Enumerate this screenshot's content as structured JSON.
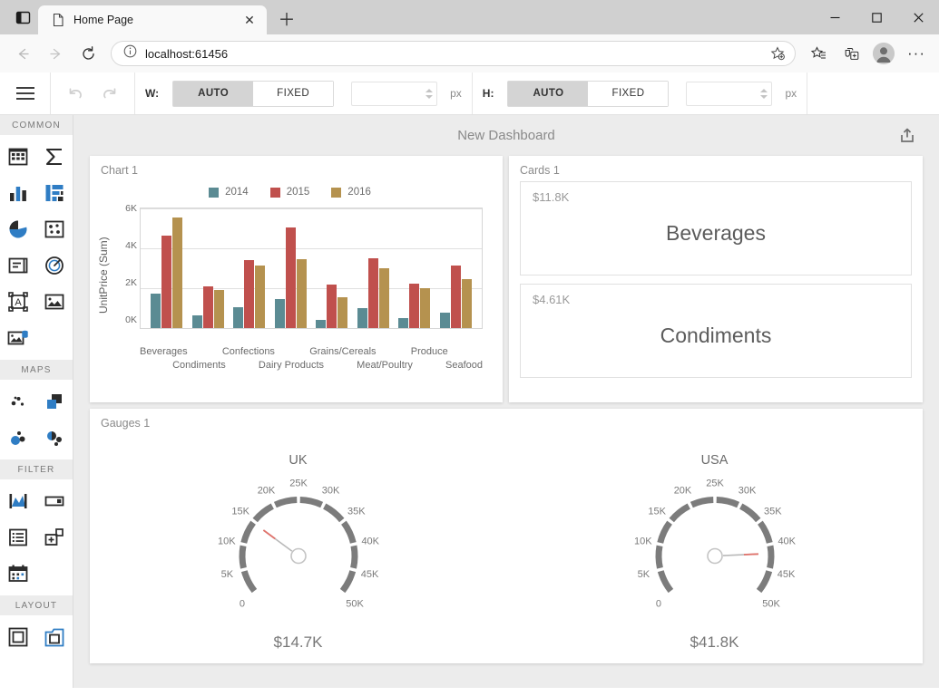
{
  "browser": {
    "tab": {
      "title": "Home Page",
      "favicon_icon": "page-icon",
      "close_icon": "close-icon"
    },
    "tab_list_icon": "tab-list-icon",
    "new_tab_icon": "plus-icon",
    "window": {
      "minimize": "minimize-icon",
      "maximize": "maximize-icon",
      "close": "close-icon"
    },
    "nav": {
      "back_icon": "back-arrow-icon",
      "forward_icon": "forward-arrow-icon",
      "reload_icon": "reload-icon",
      "info_icon": "info-circle-icon",
      "url": "localhost:61456",
      "url_host": "localhost",
      "url_port": ":61456",
      "favorite_icon": "star-add-icon",
      "collections_icon": "collections-icon",
      "tab_collection_icon": "tab-collection-icon",
      "profile_icon": "profile-avatar-icon",
      "settings_icon": "ellipsis-icon"
    }
  },
  "toolbar": {
    "menu_icon": "hamburger-menu-icon",
    "undo_icon": "undo-icon",
    "redo_icon": "redo-icon",
    "width": {
      "label": "W:",
      "auto_label": "AUTO",
      "fixed_label": "FIXED",
      "selected": "AUTO",
      "value": "",
      "unit": "px"
    },
    "height": {
      "label": "H:",
      "auto_label": "AUTO",
      "fixed_label": "FIXED",
      "selected": "AUTO",
      "value": "",
      "unit": "px"
    }
  },
  "sidebar": {
    "sections": [
      {
        "title": "COMMON",
        "items": [
          {
            "name": "grid-icon",
            "label": "Grid"
          },
          {
            "name": "sigma-icon",
            "label": "Sum"
          },
          {
            "name": "bar-chart-icon",
            "label": "Chart"
          },
          {
            "name": "pivot-grid-icon",
            "label": "Pivot"
          },
          {
            "name": "pie-chart-icon",
            "label": "Pies"
          },
          {
            "name": "scatter-chart-icon",
            "label": "Scatter"
          },
          {
            "name": "card-icon",
            "label": "Cards"
          },
          {
            "name": "gauge-icon",
            "label": "Gauges"
          },
          {
            "name": "text-box-icon",
            "label": "Text Box"
          },
          {
            "name": "image-icon",
            "label": "Image"
          },
          {
            "name": "bound-image-icon",
            "label": "Bound Image"
          }
        ]
      },
      {
        "title": "MAPS",
        "items": [
          {
            "name": "geo-point-map-icon",
            "label": "Geo Point Map"
          },
          {
            "name": "choropleth-map-icon",
            "label": "Choropleth Map"
          },
          {
            "name": "bubble-map-icon",
            "label": "Bubble Map"
          },
          {
            "name": "pie-map-icon",
            "label": "Pie Map"
          }
        ]
      },
      {
        "title": "FILTER",
        "items": [
          {
            "name": "range-filter-icon",
            "label": "Range Filter"
          },
          {
            "name": "combo-box-icon",
            "label": "Combo Box"
          },
          {
            "name": "list-box-icon",
            "label": "List Box"
          },
          {
            "name": "tree-view-icon",
            "label": "Tree View"
          },
          {
            "name": "date-filter-icon",
            "label": "Date Filter"
          }
        ]
      },
      {
        "title": "LAYOUT",
        "items": [
          {
            "name": "group-icon",
            "label": "Group"
          },
          {
            "name": "tab-container-icon",
            "label": "Tab Container"
          }
        ]
      }
    ]
  },
  "dashboard": {
    "title": "New Dashboard",
    "export_icon": "export-share-icon",
    "chart_panel_title": "Chart 1",
    "cards_panel_title": "Cards 1",
    "gauges_panel_title": "Gauges 1",
    "cards": [
      {
        "value": "$11.8K",
        "name": "Beverages"
      },
      {
        "value": "$4.61K",
        "name": "Condiments"
      }
    ],
    "gauges": [
      {
        "name": "UK",
        "total": "$14.7K",
        "value": 14700,
        "min": 0,
        "max": 50000,
        "ticks": [
          "0",
          "5K",
          "10K",
          "15K",
          "20K",
          "25K",
          "30K",
          "35K",
          "40K",
          "45K",
          "50K"
        ]
      },
      {
        "name": "USA",
        "total": "$41.8K",
        "value": 41800,
        "min": 0,
        "max": 50000,
        "ticks": [
          "0",
          "5K",
          "10K",
          "15K",
          "20K",
          "25K",
          "30K",
          "35K",
          "40K",
          "45K",
          "50K"
        ]
      }
    ]
  },
  "chart_data": {
    "type": "bar",
    "title": "Chart 1",
    "xlabel": "",
    "ylabel": "UnitPrice (Sum)",
    "ylim": [
      0,
      6000
    ],
    "ytick_labels": [
      "0K",
      "2K",
      "4K",
      "6K"
    ],
    "ytick_values": [
      0,
      2000,
      4000,
      6000
    ],
    "grid": true,
    "legend_position": "top",
    "categories": [
      "Beverages",
      "Condiments",
      "Confections",
      "Dairy Products",
      "Grains/Cereals",
      "Meat/Poultry",
      "Produce",
      "Seafood"
    ],
    "series": [
      {
        "name": "2014",
        "color": "#5b8b93",
        "values": [
          1720,
          620,
          1040,
          1450,
          390,
          1000,
          500,
          780
        ]
      },
      {
        "name": "2015",
        "color": "#c0504d",
        "values": [
          4630,
          2080,
          3390,
          5030,
          2180,
          3500,
          2220,
          3120
        ]
      },
      {
        "name": "2016",
        "color": "#b5924f",
        "values": [
          5560,
          1930,
          3120,
          3450,
          1560,
          3020,
          2020,
          2440
        ]
      }
    ]
  }
}
